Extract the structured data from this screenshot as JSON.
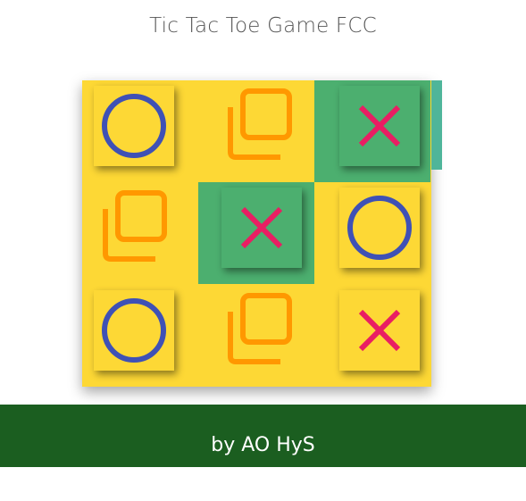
{
  "title": "Tic Tac Toe Game FCC",
  "footer": {
    "text": "by AO HyS"
  },
  "colors": {
    "board": "#fdd835",
    "win": "#4caf6f",
    "o_mark": "#3f51b5",
    "x_mark": "#e91e63",
    "empty_icon": "#ff9800",
    "footer_bg": "#1b5e20"
  },
  "board": [
    [
      "O",
      "",
      "X"
    ],
    [
      "",
      "X",
      "O"
    ],
    [
      "O",
      "",
      "X"
    ]
  ],
  "winning_cells": [
    "0-2",
    "1-1"
  ]
}
